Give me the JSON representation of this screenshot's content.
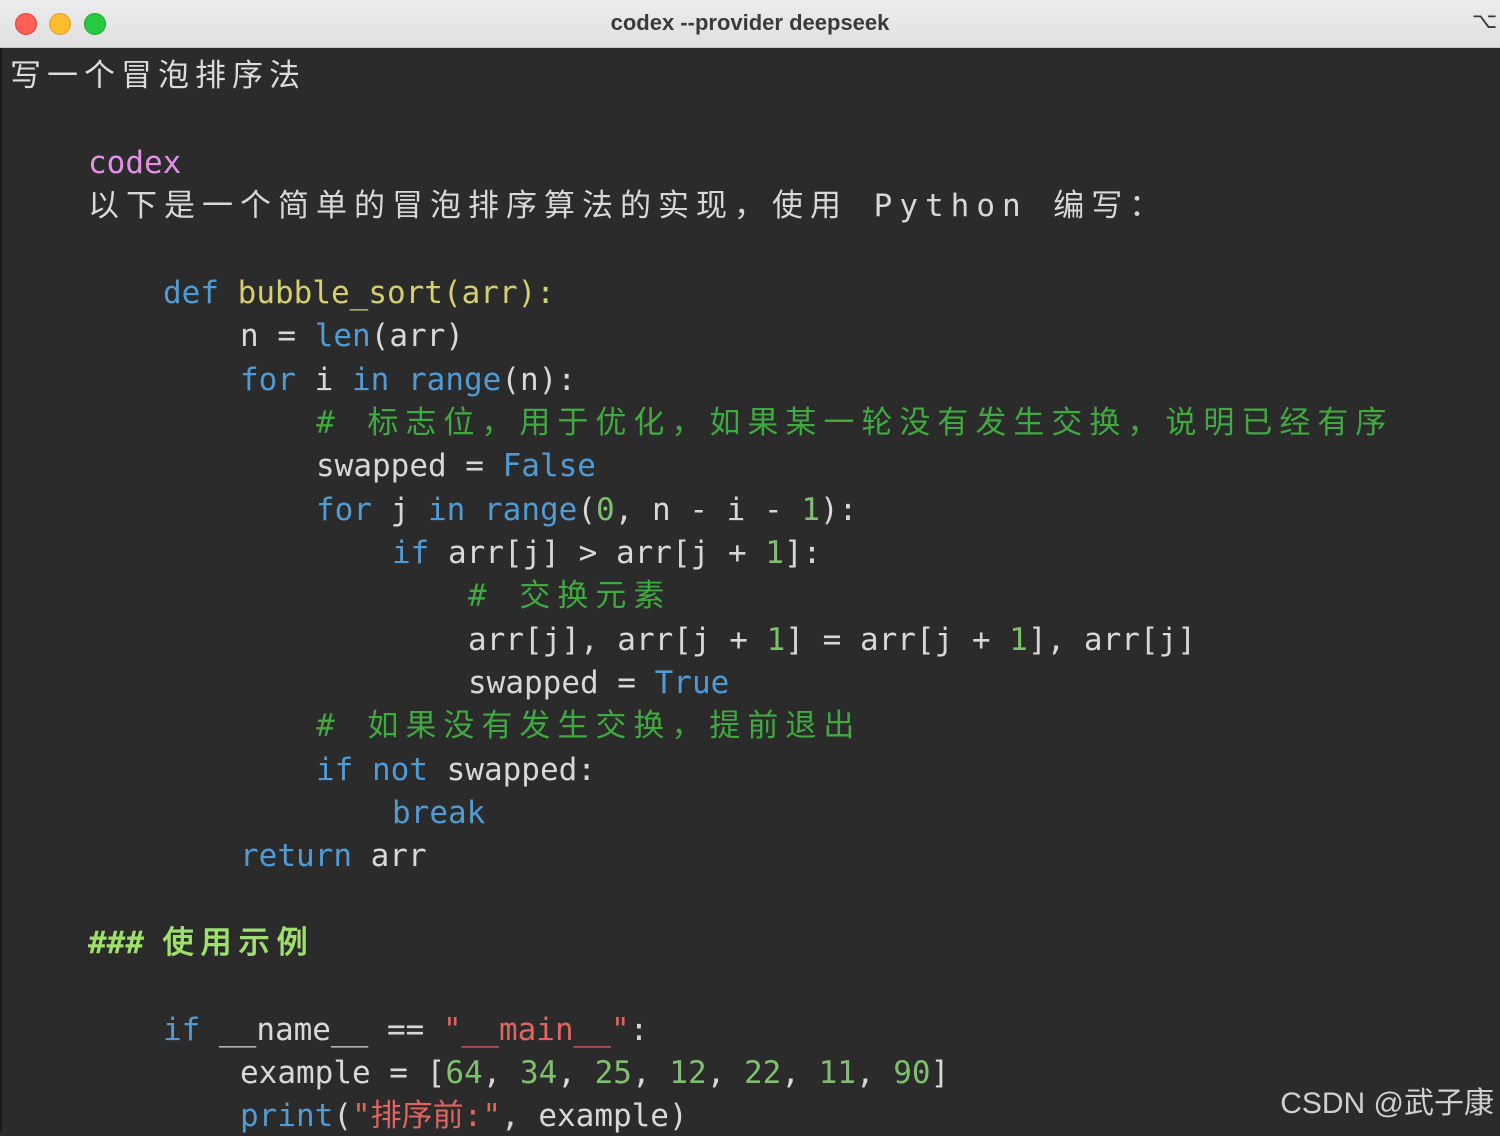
{
  "window": {
    "title": "codex --provider deepseek",
    "shortcut": "⌥⌘"
  },
  "terminal": {
    "prompt": "写一个冒泡排序法",
    "agent_name": "codex",
    "intro": "以下是一个简单的冒泡排序算法的实现，使用 Python 编写：",
    "code": {
      "l1_def": "def",
      "l1_fn": "bubble_sort(arr):",
      "l2_a": "n = ",
      "l2_len": "len",
      "l2_b": "(arr)",
      "l3_for": "for",
      "l3_i": " i ",
      "l3_in": "in",
      "l3_range": "range",
      "l3_b": "(n):",
      "l4_comment": "# 标志位，用于优化，如果某一轮没有发生交换，说明已经有序",
      "l5_a": "swapped = ",
      "l5_false": "False",
      "l6_for": "for",
      "l6_j": " j ",
      "l6_in": "in",
      "l6_range": "range",
      "l6_p1": "(",
      "l6_zero": "0",
      "l6_mid": ", n - i - ",
      "l6_one": "1",
      "l6_end": "):",
      "l7_if": "if",
      "l7_a": " arr[j] > arr[j + ",
      "l7_one": "1",
      "l7_end": "]:",
      "l8_comment": "# 交换元素",
      "l9_a": "arr[j], arr[j + ",
      "l9_one": "1",
      "l9_b": "] = arr[j + ",
      "l9_one2": "1",
      "l9_c": "], arr[j]",
      "l10_a": "swapped = ",
      "l10_true": "True",
      "l11_comment": "# 如果没有发生交换，提前退出",
      "l12_if": "if",
      "l12_not": " not",
      "l12_b": " swapped:",
      "l13_break": "break",
      "l14_return": "return",
      "l14_b": " arr"
    },
    "heading_hash": "###",
    "heading_text": "使用示例",
    "example": {
      "e1_if": "if",
      "e1_a": " __name__ == ",
      "e1_str": "\"__main__\"",
      "e1_b": ":",
      "e2_a": "example = [",
      "e2_n1": "64",
      "e2_n2": "34",
      "e2_n3": "25",
      "e2_n4": "12",
      "e2_n5": "22",
      "e2_n6": "11",
      "e2_n7": "90",
      "e2_sep": ", ",
      "e2_end": "]",
      "e3_print": "print",
      "e3_p": "(",
      "e3_str": "\"排序前:\"",
      "e3_b": ", example)"
    }
  },
  "watermark": "CSDN @武子康"
}
